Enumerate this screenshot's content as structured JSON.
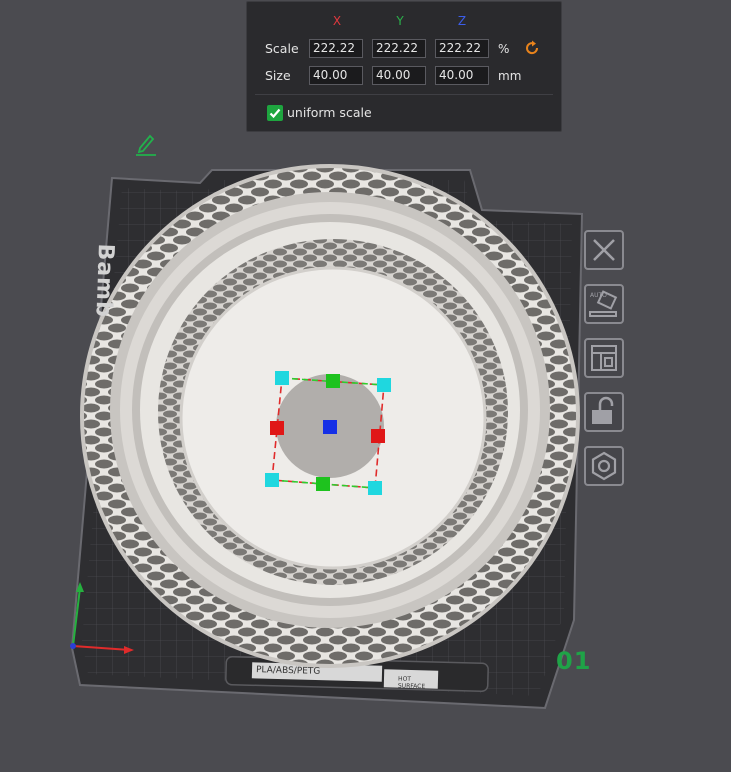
{
  "scale_panel": {
    "axis_headers": {
      "x": "X",
      "y": "Y",
      "z": "Z"
    },
    "scale": {
      "label": "Scale",
      "x": "222.22",
      "y": "222.22",
      "z": "222.22",
      "unit": "%"
    },
    "size": {
      "label": "Size",
      "x": "40.00",
      "y": "40.00",
      "z": "40.00",
      "unit": "mm"
    },
    "uniform_scale": {
      "label": "uniform scale",
      "checked": true
    },
    "reset_icon": "rotate-reset-icon"
  },
  "build_plate": {
    "brand_fragment": "Bamb",
    "label_strip_text": "PLA/ABS/PETG",
    "hot_surface_text": "HOT SURFACE",
    "plate_number": "01"
  },
  "right_toolbar": [
    {
      "name": "close-icon"
    },
    {
      "name": "auto-orient-icon",
      "text": "AUTO"
    },
    {
      "name": "arrange-icon"
    },
    {
      "name": "lock-icon"
    },
    {
      "name": "settings-hex-icon"
    }
  ],
  "colors": {
    "viewport_bg": "#4b4b50",
    "panel_bg": "#2a2a2d",
    "axis_x": "#e0383e",
    "axis_y": "#2bb04a",
    "axis_z": "#3c5de8",
    "accent_orange": "#e8831c",
    "check_green": "#1ea53f",
    "plate_number_green": "#1fa347"
  }
}
